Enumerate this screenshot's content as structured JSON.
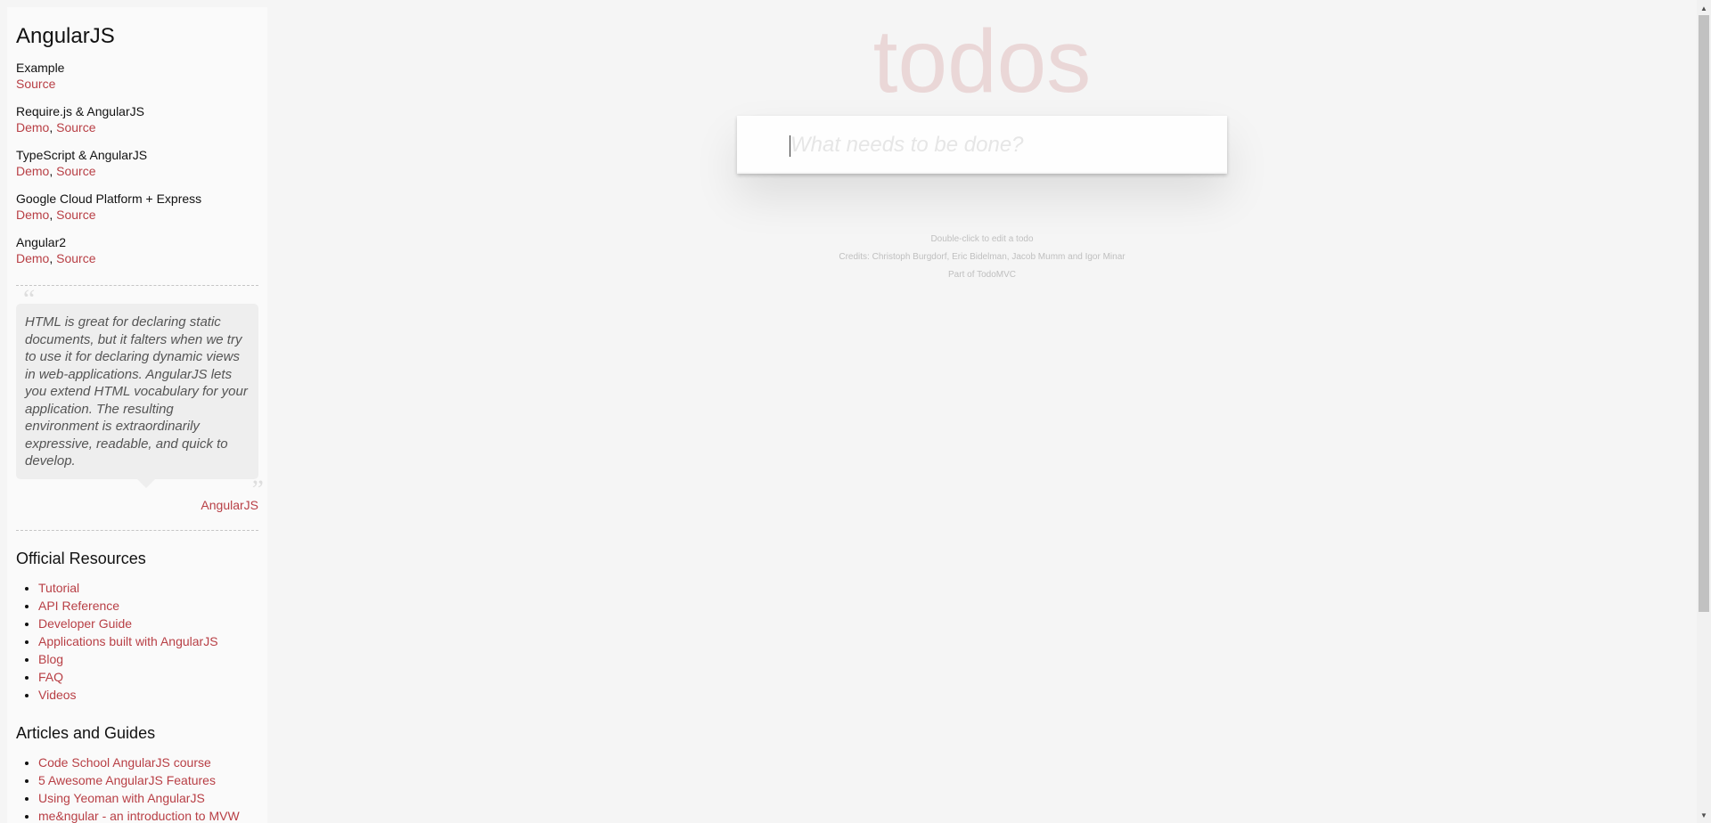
{
  "sidebar": {
    "title": "AngularJS",
    "examples": [
      {
        "name": "Example",
        "links": [
          "Source"
        ]
      },
      {
        "name": "Require.js & AngularJS",
        "links": [
          "Demo",
          "Source"
        ]
      },
      {
        "name": "TypeScript & AngularJS",
        "links": [
          "Demo",
          "Source"
        ]
      },
      {
        "name": "Google Cloud Platform + Express",
        "links": [
          "Demo",
          "Source"
        ]
      },
      {
        "name": "Angular2",
        "links": [
          "Demo",
          "Source"
        ]
      }
    ],
    "quote": {
      "text": "HTML is great for declaring static documents, but it falters when we try to use it for declaring dynamic views in web-applications. AngularJS lets you extend HTML vocabulary for your application. The resulting environment is extraordinarily expressive, readable, and quick to develop.",
      "source": "AngularJS"
    },
    "official_resources": {
      "title": "Official Resources",
      "items": [
        "Tutorial",
        "API Reference",
        "Developer Guide",
        "Applications built with AngularJS",
        "Blog",
        "FAQ",
        "Videos"
      ]
    },
    "articles": {
      "title": "Articles and Guides",
      "items": [
        "Code School AngularJS course",
        "5 Awesome AngularJS Features",
        "Using Yeoman with AngularJS",
        "me&ngular - an introduction to MVW"
      ]
    }
  },
  "main": {
    "title": "todos",
    "new_todo_placeholder": "What needs to be done?",
    "new_todo_value": "",
    "info": {
      "hint": "Double-click to edit a todo",
      "credits": "Credits: Christoph Burgdorf, Eric Bidelman, Jacob Mumm and Igor Minar",
      "part_of": "Part of TodoMVC"
    }
  },
  "colors": {
    "link": "#b83f45",
    "title": "rgba(175, 47, 47, 0.15)",
    "background": "#f5f5f5"
  }
}
